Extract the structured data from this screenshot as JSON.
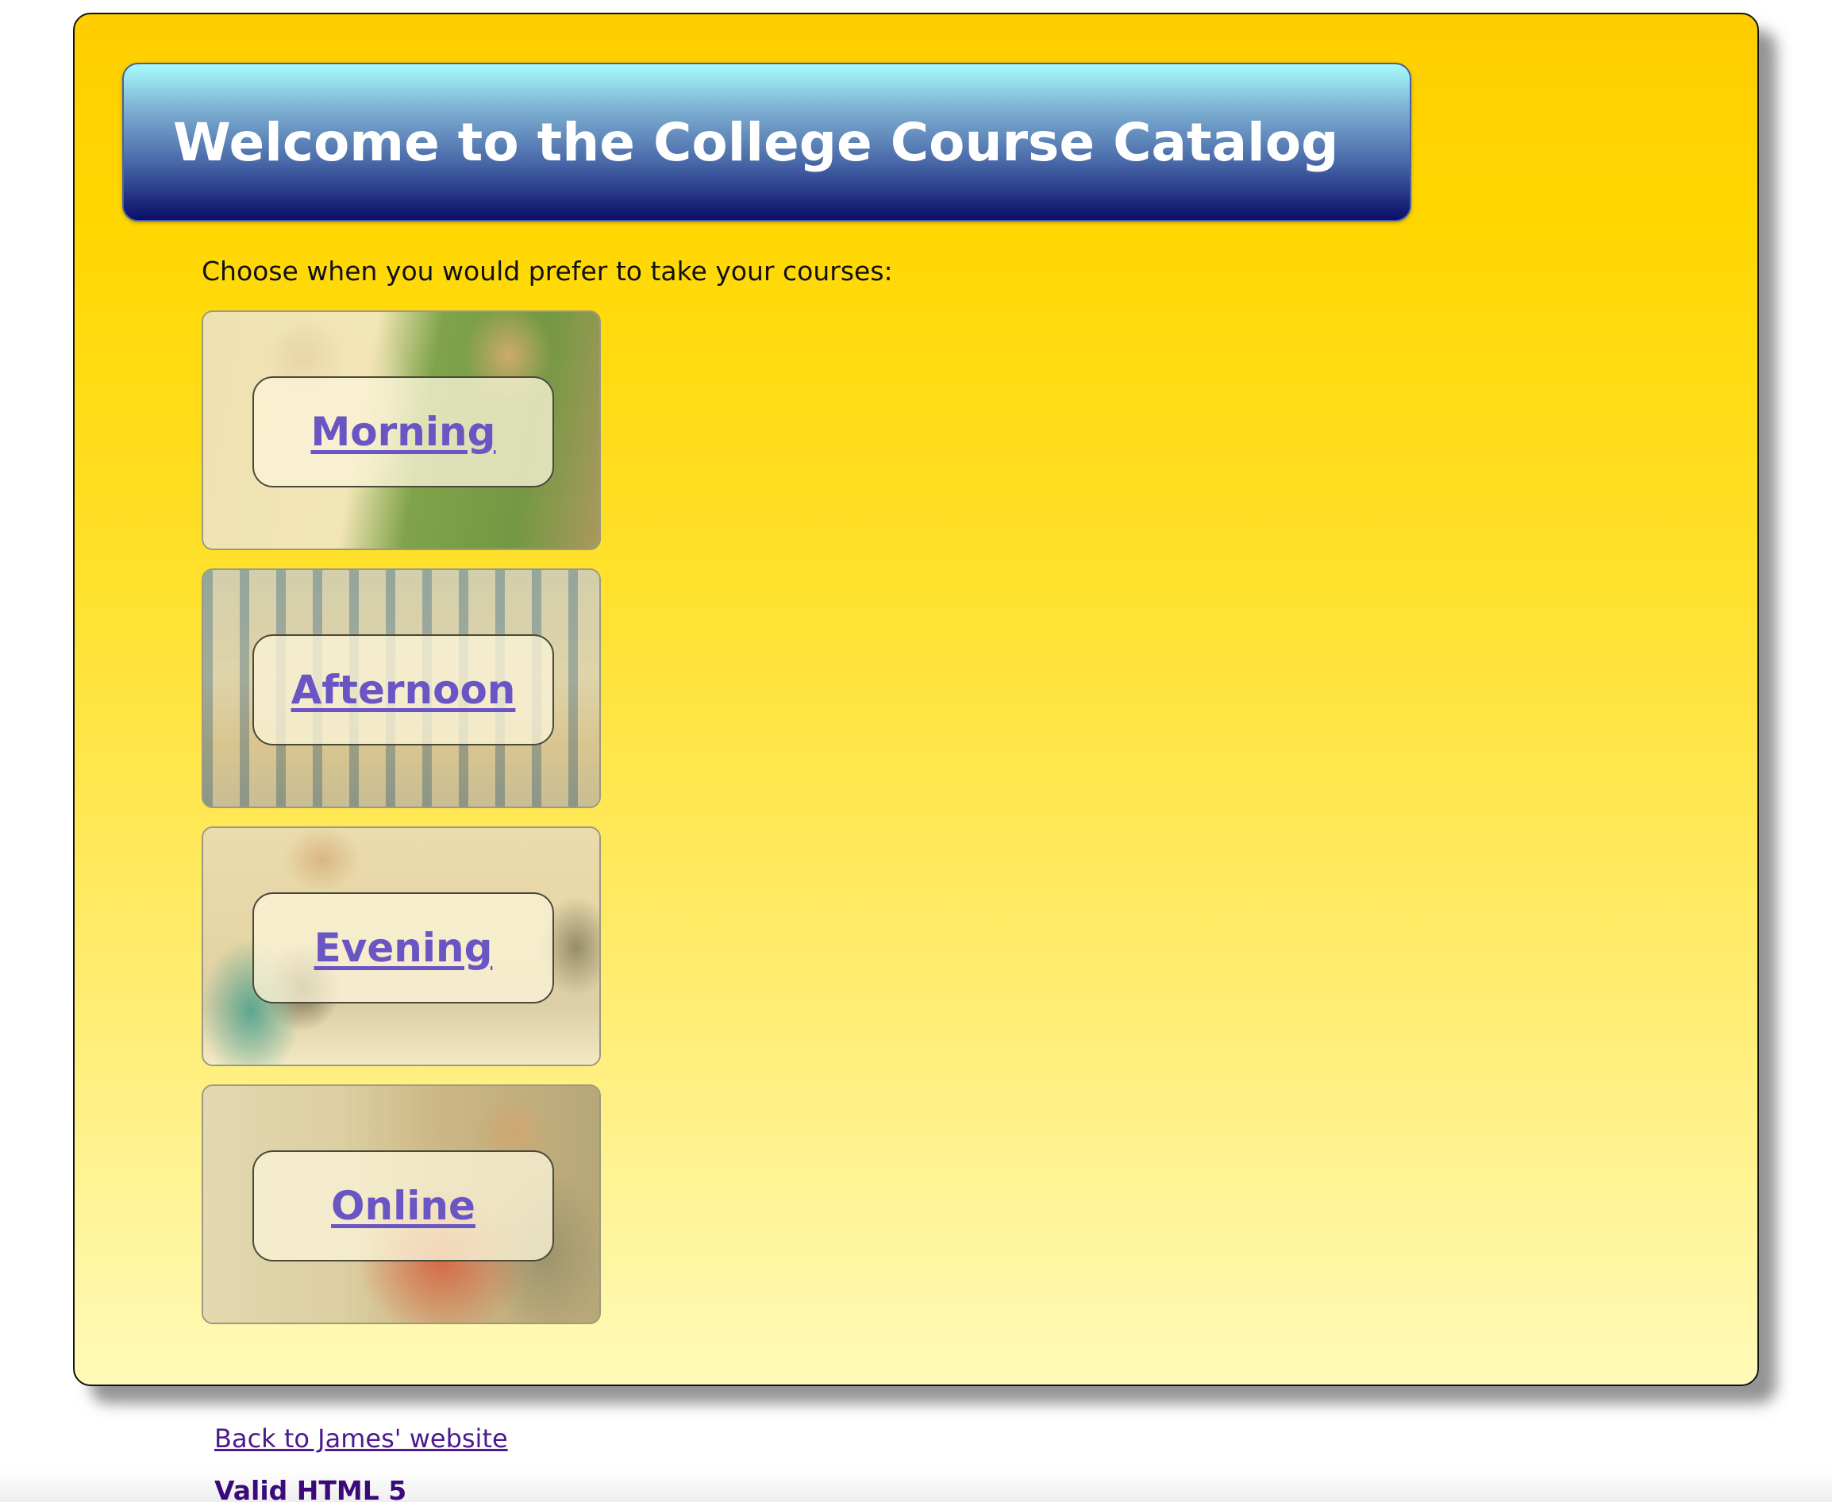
{
  "header": {
    "title": "Welcome to the College Course Catalog"
  },
  "main": {
    "prompt": "Choose when you would prefer to take your courses:",
    "options": [
      {
        "label": "Morning"
      },
      {
        "label": "Afternoon"
      },
      {
        "label": "Evening"
      },
      {
        "label": "Online"
      }
    ]
  },
  "footer": {
    "back_link": "Back to James' website",
    "validation": "Valid HTML 5"
  },
  "colors": {
    "page_gradient_top": "#ffcd00",
    "page_gradient_bottom": "#fffab8",
    "banner_top": "#a6fbfb",
    "banner_bottom": "#0a0f69",
    "option_link": "#6a55c4",
    "footer_link": "#4b1a8c"
  }
}
